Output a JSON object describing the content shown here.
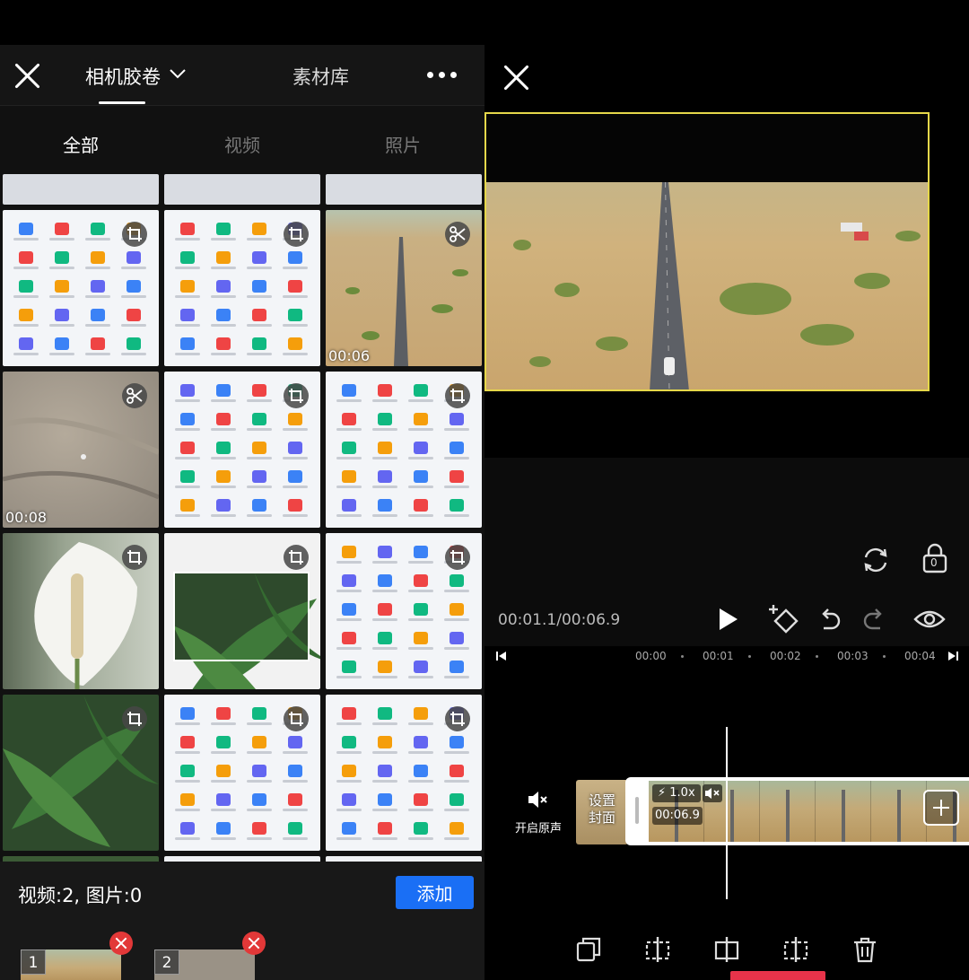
{
  "picker": {
    "album_title": "相机胶卷",
    "library_tab": "素材库",
    "filters": [
      "全部",
      "视频",
      "照片"
    ],
    "active_filter": 0,
    "grid": [
      {
        "kind": "doc",
        "badge": "crop-icon"
      },
      {
        "kind": "doc",
        "badge": "crop-icon"
      },
      {
        "kind": "road",
        "badge": "scissors-icon",
        "duration": "00:06"
      },
      {
        "kind": "sand",
        "badge": "scissors-icon",
        "duration": "00:08"
      },
      {
        "kind": "doc",
        "badge": "crop-icon"
      },
      {
        "kind": "doc",
        "badge": "crop-icon"
      },
      {
        "kind": "flower",
        "badge": "crop-icon"
      },
      {
        "kind": "leaf",
        "badge": "crop-icon"
      },
      {
        "kind": "doc",
        "badge": "crop-icon"
      },
      {
        "kind": "leaf",
        "badge": "crop-icon"
      },
      {
        "kind": "doc",
        "badge": "crop-icon"
      },
      {
        "kind": "doc",
        "badge": "crop-icon"
      }
    ],
    "selection_count": "视频:2, 图片:0",
    "add_label": "添加",
    "selected": [
      {
        "num": "1"
      },
      {
        "num": "2"
      }
    ]
  },
  "editor": {
    "time_readout": "00:01.1/00:06.9",
    "ruler_ticks": [
      "00:00",
      "00:01",
      "00:02",
      "00:03",
      "00:04"
    ],
    "mute_original_label": "开启原声",
    "cover_label": "设置\n封面",
    "speed": "1.0x",
    "clip_duration": "00:06.9",
    "lock_count": "0",
    "accent": "#e6d84a",
    "action_accent": "#1a6ff5"
  }
}
